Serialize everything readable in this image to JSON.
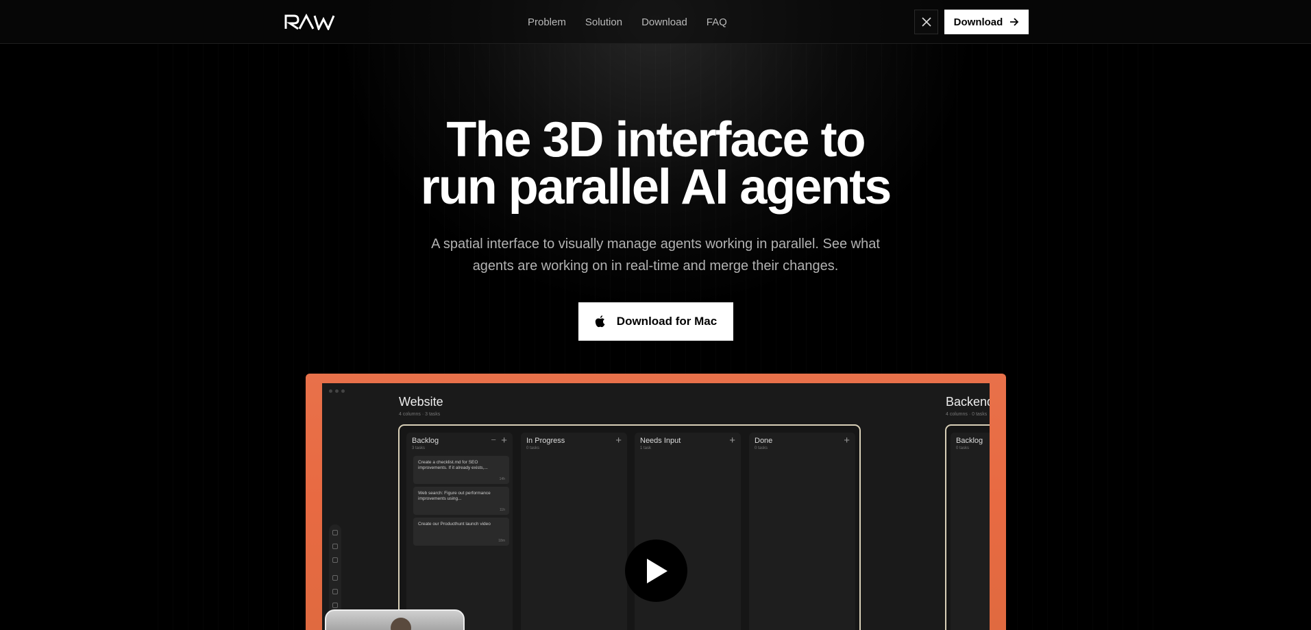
{
  "brand": {
    "logo_alt": "RAW"
  },
  "nav": {
    "items": [
      "Problem",
      "Solution",
      "Download",
      "FAQ"
    ]
  },
  "header": {
    "download_label": "Download",
    "x_icon": "x-logo-icon"
  },
  "hero": {
    "title_line1": "The 3D interface to",
    "title_line2": "run parallel AI agents",
    "subtitle": "A spatial interface to visually manage agents working in parallel. See what agents are working on in real-time and merge their changes.",
    "cta_label": "Download for Mac"
  },
  "preview": {
    "workspace1": {
      "title": "Website",
      "subtitle": "4 columns · 3 tasks"
    },
    "workspace2": {
      "title": "Backend",
      "subtitle": "4 columns · 0 tasks"
    },
    "columns": [
      {
        "name": "Backlog",
        "count": "3 tasks"
      },
      {
        "name": "In Progress",
        "count": "0 tasks"
      },
      {
        "name": "Needs Input",
        "count": "1 task"
      },
      {
        "name": "Done",
        "count": "0 tasks"
      }
    ],
    "column2_backlog": {
      "name": "Backlog",
      "count": "0 tasks"
    },
    "cards": [
      {
        "text": "Create a checklist.md for SEO improvements. If it already exists,...",
        "time": "14h"
      },
      {
        "text": "Web search: Figure out performance improvements using...",
        "time": "11h"
      },
      {
        "text": "Create our Producthunt launch video",
        "time": "18m"
      }
    ]
  },
  "colors": {
    "accent_frame": "#e8714a",
    "background": "#000000",
    "button_bg": "#ffffff"
  }
}
